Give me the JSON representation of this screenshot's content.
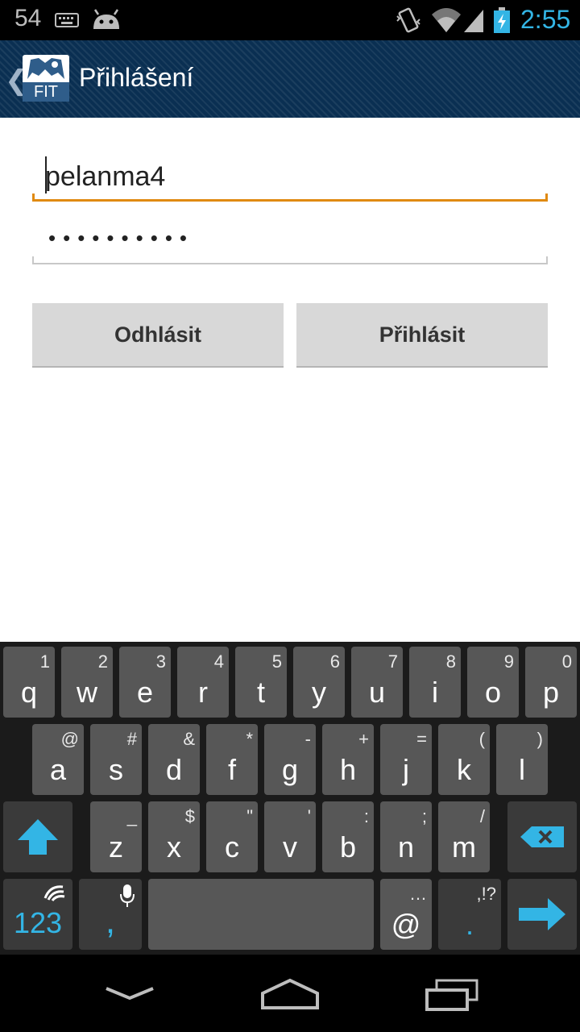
{
  "status_bar": {
    "notification_count": "54",
    "time": "2:55"
  },
  "action_bar": {
    "logo_text": "FIT",
    "title": "Přihlášení"
  },
  "form": {
    "username_value": "pelanma4",
    "password_mask": "••••••••••"
  },
  "buttons": {
    "logout_label": "Odhlásit",
    "login_label": "Přihlásit"
  },
  "keyboard": {
    "row1": [
      {
        "main": "q",
        "hint": "1"
      },
      {
        "main": "w",
        "hint": "2"
      },
      {
        "main": "e",
        "hint": "3"
      },
      {
        "main": "r",
        "hint": "4"
      },
      {
        "main": "t",
        "hint": "5"
      },
      {
        "main": "y",
        "hint": "6"
      },
      {
        "main": "u",
        "hint": "7"
      },
      {
        "main": "i",
        "hint": "8"
      },
      {
        "main": "o",
        "hint": "9"
      },
      {
        "main": "p",
        "hint": "0"
      }
    ],
    "row2": [
      {
        "main": "a",
        "hint": "@"
      },
      {
        "main": "s",
        "hint": "#"
      },
      {
        "main": "d",
        "hint": "&"
      },
      {
        "main": "f",
        "hint": "*"
      },
      {
        "main": "g",
        "hint": "-"
      },
      {
        "main": "h",
        "hint": "+"
      },
      {
        "main": "j",
        "hint": "="
      },
      {
        "main": "k",
        "hint": "("
      },
      {
        "main": "l",
        "hint": ")"
      }
    ],
    "row3": [
      {
        "main": "z",
        "hint": "_"
      },
      {
        "main": "x",
        "hint": "$"
      },
      {
        "main": "c",
        "hint": "\""
      },
      {
        "main": "v",
        "hint": "'"
      },
      {
        "main": "b",
        "hint": ":"
      },
      {
        "main": "n",
        "hint": ";"
      },
      {
        "main": "m",
        "hint": "/"
      }
    ],
    "row4": {
      "numbers_label": "123",
      "comma_label": ",",
      "at_label": "@",
      "at_hint": "…",
      "period_label": ".",
      "period_hint": ",!?"
    }
  }
}
